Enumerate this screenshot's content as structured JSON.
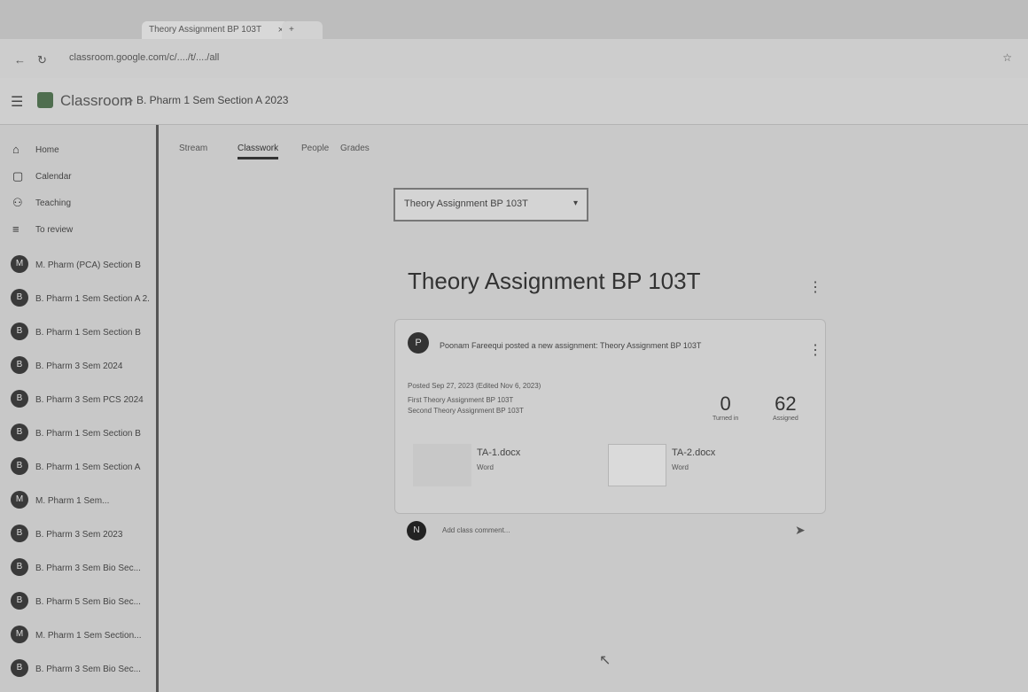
{
  "browser": {
    "active_tab_title": "Theory Assignment BP 103T",
    "tab_close": "×",
    "new_tab": "+",
    "url": "classroom.google.com/c/..../t/..../all",
    "back_icon": "arrow-left-icon",
    "reload_icon": "reload-icon",
    "star_icon": "star-icon"
  },
  "header": {
    "app_name": "Classroom",
    "separator": ">",
    "class_name": "B. Pharm 1 Sem Section A 2023"
  },
  "sidebar": {
    "items": [
      {
        "icon": "home-icon",
        "glyph": "⌂",
        "label": "Home"
      },
      {
        "icon": "calendar-icon",
        "glyph": "▢",
        "label": "Calendar"
      },
      {
        "icon": "people-icon",
        "glyph": "⚇",
        "label": "Teaching"
      },
      {
        "icon": "todo-icon",
        "glyph": "≡",
        "label": "To review"
      }
    ],
    "classes": [
      {
        "initial": "M",
        "label": "M. Pharm (PCA) Section B"
      },
      {
        "initial": "B",
        "label": "B. Pharm 1 Sem Section A 2..."
      },
      {
        "initial": "B",
        "label": "B. Pharm 1 Sem Section B"
      },
      {
        "initial": "B",
        "label": "B. Pharm 3 Sem 2024"
      },
      {
        "initial": "B",
        "label": "B. Pharm 3 Sem PCS 2024"
      },
      {
        "initial": "B",
        "label": "B. Pharm 1 Sem Section B"
      },
      {
        "initial": "B",
        "label": "B. Pharm 1 Sem Section A"
      },
      {
        "initial": "M",
        "label": "M. Pharm 1 Sem..."
      },
      {
        "initial": "B",
        "label": "B. Pharm 3 Sem 2023"
      },
      {
        "initial": "B",
        "label": "B. Pharm 3 Sem Bio Sec..."
      },
      {
        "initial": "B",
        "label": "B. Pharm 5 Sem Bio Sec..."
      },
      {
        "initial": "M",
        "label": "M. Pharm 1 Sem Section..."
      },
      {
        "initial": "B",
        "label": "B. Pharm 3 Sem Bio Sec..."
      }
    ]
  },
  "class_tabs": [
    "Stream",
    "Classwork",
    "People",
    "Grades"
  ],
  "topic_select": {
    "value": "Theory Assignment BP 103T",
    "arrow": "▾"
  },
  "assignment": {
    "title": "Theory Assignment BP 103T",
    "post_text": "Poonam Fareequi posted a new assignment: Theory Assignment BP 103T",
    "posted": "Posted Sep 27, 2023 (Edited Nov 6, 2023)",
    "line2": "First Theory Assignment BP 103T",
    "line3": "Second Theory Assignment BP 103T",
    "turned_in_count": "0",
    "turned_in_label": "Turned in",
    "assigned_count": "62",
    "assigned_label": "Assigned",
    "attachments": [
      {
        "name": "TA-1.docx",
        "type": "Word"
      },
      {
        "name": "TA-2.docx",
        "type": "Word"
      }
    ],
    "comment_placeholder": "Add class comment..."
  }
}
